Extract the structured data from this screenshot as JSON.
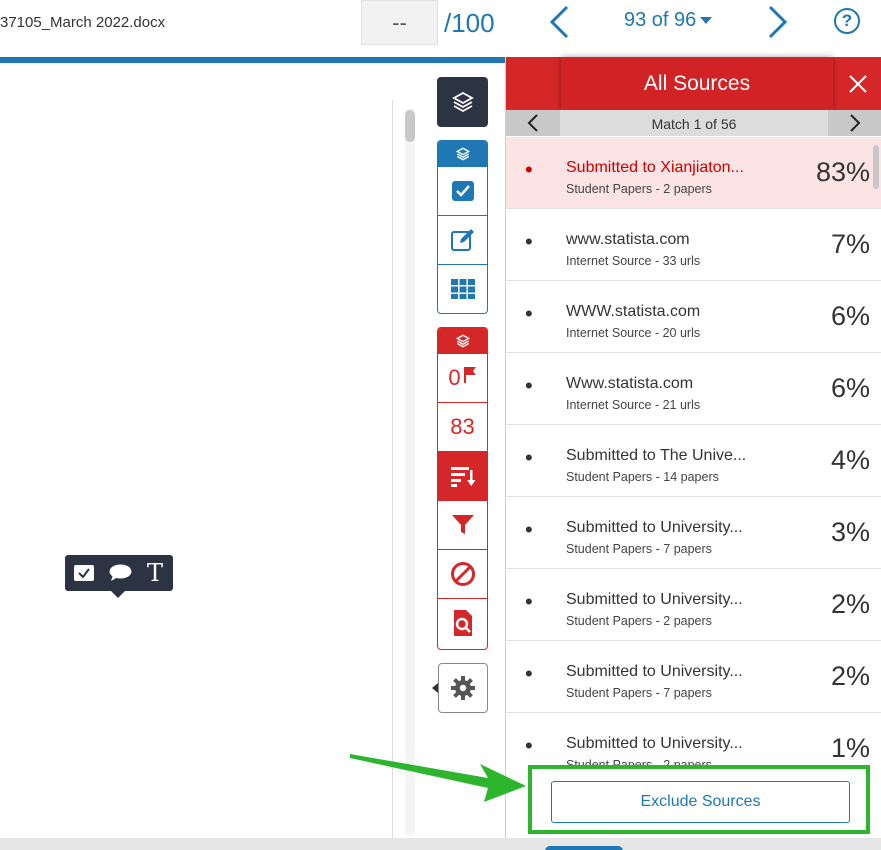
{
  "top": {
    "filename": "37105_March 2022.docx",
    "grade_value": "--",
    "grade_max": "/100",
    "page_counter": "93 of 96",
    "help_label": "?"
  },
  "tooltip": {
    "text_tool": "T"
  },
  "tools": {
    "red_group": {
      "flags": "0",
      "similarity": "83"
    }
  },
  "panel": {
    "title": "All Sources",
    "match": "Match 1 of 56"
  },
  "sources": [
    {
      "bullet": "•",
      "name": "Submitted to Xianjiaton...",
      "sub": "Student Papers - 2 papers",
      "pct": "83%",
      "active": true
    },
    {
      "bullet": "•",
      "name": "www.statista.com",
      "sub": "Internet Source - 33 urls",
      "pct": "7%"
    },
    {
      "bullet": "•",
      "name": "WWW.statista.com",
      "sub": "Internet Source - 20 urls",
      "pct": "6%"
    },
    {
      "bullet": "•",
      "name": "Www.statista.com",
      "sub": "Internet Source - 21 urls",
      "pct": "6%"
    },
    {
      "bullet": "•",
      "name": "Submitted to The Unive...",
      "sub": "Student Papers - 14 papers",
      "pct": "4%"
    },
    {
      "bullet": "•",
      "name": "Submitted to University...",
      "sub": "Student Papers - 7 papers",
      "pct": "3%"
    },
    {
      "bullet": "•",
      "name": "Submitted to University...",
      "sub": "Student Papers - 2 papers",
      "pct": "2%"
    },
    {
      "bullet": "•",
      "name": "Submitted to University...",
      "sub": "Student Papers - 7 papers",
      "pct": "2%"
    },
    {
      "bullet": "•",
      "name": "Submitted to University...",
      "sub": "Student Papers - 2 papers",
      "pct": "1%"
    }
  ],
  "exclude_label": "Exclude Sources",
  "colors": {
    "accent_blue": "#1f77b4",
    "accent_red": "#d62728",
    "highlight_green": "#2db52d",
    "dark": "#2c3444"
  }
}
